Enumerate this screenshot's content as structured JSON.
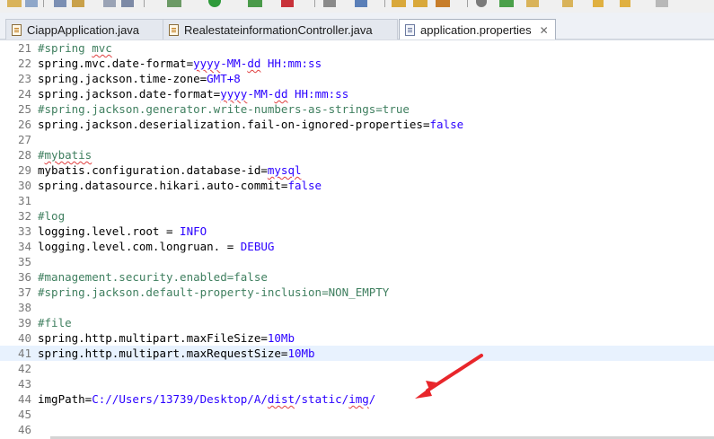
{
  "tabs": [
    {
      "label": "CiappApplication.java",
      "icon": "java-file-icon",
      "active": false
    },
    {
      "label": "RealestateinformationController.java",
      "icon": "java-file-icon",
      "active": false
    },
    {
      "label": "application.properties",
      "icon": "properties-file-icon",
      "active": true
    }
  ],
  "tab_close_glyph": "✕",
  "current_line": 41,
  "lines": [
    {
      "n": "21",
      "segments": [
        {
          "t": "#spring ",
          "s": "c"
        },
        {
          "t": "mvc",
          "s": "c sq"
        }
      ]
    },
    {
      "n": "22",
      "segments": [
        {
          "t": "spring.mvc.date-format=",
          "s": "k"
        },
        {
          "t": "yyyy",
          "s": "v sq"
        },
        {
          "t": "-MM-",
          "s": "v"
        },
        {
          "t": "dd",
          "s": "v sq"
        },
        {
          "t": " HH:mm:ss",
          "s": "v"
        }
      ]
    },
    {
      "n": "23",
      "segments": [
        {
          "t": "spring.jackson.time-zone=",
          "s": "k"
        },
        {
          "t": "GMT+8",
          "s": "v"
        }
      ]
    },
    {
      "n": "24",
      "segments": [
        {
          "t": "spring.jackson.date-format=",
          "s": "k"
        },
        {
          "t": "yyyy",
          "s": "v sq"
        },
        {
          "t": "-MM-",
          "s": "v"
        },
        {
          "t": "dd",
          "s": "v sq"
        },
        {
          "t": " HH:mm:ss",
          "s": "v"
        }
      ]
    },
    {
      "n": "25",
      "segments": [
        {
          "t": "#spring.jackson.generator.write-numbers-as-strings=true",
          "s": "c"
        }
      ]
    },
    {
      "n": "26",
      "segments": [
        {
          "t": "spring.jackson.deserialization.fail-on-ignored-properties=",
          "s": "k"
        },
        {
          "t": "false",
          "s": "v"
        }
      ]
    },
    {
      "n": "27",
      "segments": []
    },
    {
      "n": "28",
      "segments": [
        {
          "t": "#",
          "s": "c"
        },
        {
          "t": "mybatis",
          "s": "c sq"
        }
      ]
    },
    {
      "n": "29",
      "segments": [
        {
          "t": "mybatis.configuration.database-id=",
          "s": "k"
        },
        {
          "t": "mysql",
          "s": "v sq"
        }
      ]
    },
    {
      "n": "30",
      "segments": [
        {
          "t": "spring.datasource.hikari.auto-commit=",
          "s": "k"
        },
        {
          "t": "false",
          "s": "v"
        }
      ]
    },
    {
      "n": "31",
      "segments": []
    },
    {
      "n": "32",
      "segments": [
        {
          "t": "#log",
          "s": "c"
        }
      ]
    },
    {
      "n": "33",
      "segments": [
        {
          "t": "logging.level.root = ",
          "s": "k"
        },
        {
          "t": "INFO",
          "s": "v"
        }
      ]
    },
    {
      "n": "34",
      "segments": [
        {
          "t": "logging.level.com.longruan. = ",
          "s": "k"
        },
        {
          "t": "DEBUG",
          "s": "v"
        }
      ]
    },
    {
      "n": "35",
      "segments": []
    },
    {
      "n": "36",
      "segments": [
        {
          "t": "#management.security.enabled=false",
          "s": "c"
        }
      ]
    },
    {
      "n": "37",
      "segments": [
        {
          "t": "#spring.jackson.default-property-inclusion=NON_EMPTY",
          "s": "c"
        }
      ]
    },
    {
      "n": "38",
      "segments": []
    },
    {
      "n": "39",
      "segments": [
        {
          "t": "#file",
          "s": "c"
        }
      ]
    },
    {
      "n": "40",
      "segments": [
        {
          "t": "spring.http.multipart.maxFileSize=",
          "s": "k"
        },
        {
          "t": "10Mb",
          "s": "v"
        }
      ]
    },
    {
      "n": "41",
      "segments": [
        {
          "t": "spring.http.multipart.maxRequestSize=",
          "s": "k"
        },
        {
          "t": "10Mb",
          "s": "v"
        }
      ]
    },
    {
      "n": "42",
      "segments": []
    },
    {
      "n": "43",
      "segments": []
    },
    {
      "n": "44",
      "segments": [
        {
          "t": "imgPath=",
          "s": "k"
        },
        {
          "t": "C://Users/13739/Desktop/A/",
          "s": "v"
        },
        {
          "t": "dist",
          "s": "v sq"
        },
        {
          "t": "/static/",
          "s": "v"
        },
        {
          "t": "img",
          "s": "v sq"
        },
        {
          "t": "/",
          "s": "v"
        }
      ]
    },
    {
      "n": "45",
      "segments": []
    },
    {
      "n": "46",
      "segments": []
    }
  ],
  "colors": {
    "comment": "#3f7f5f",
    "value": "#2a00ff",
    "key": "#000000",
    "line_number": "#787878",
    "current_line_bg": "#e8f2fe",
    "annotation_arrow": "#e8262b"
  }
}
